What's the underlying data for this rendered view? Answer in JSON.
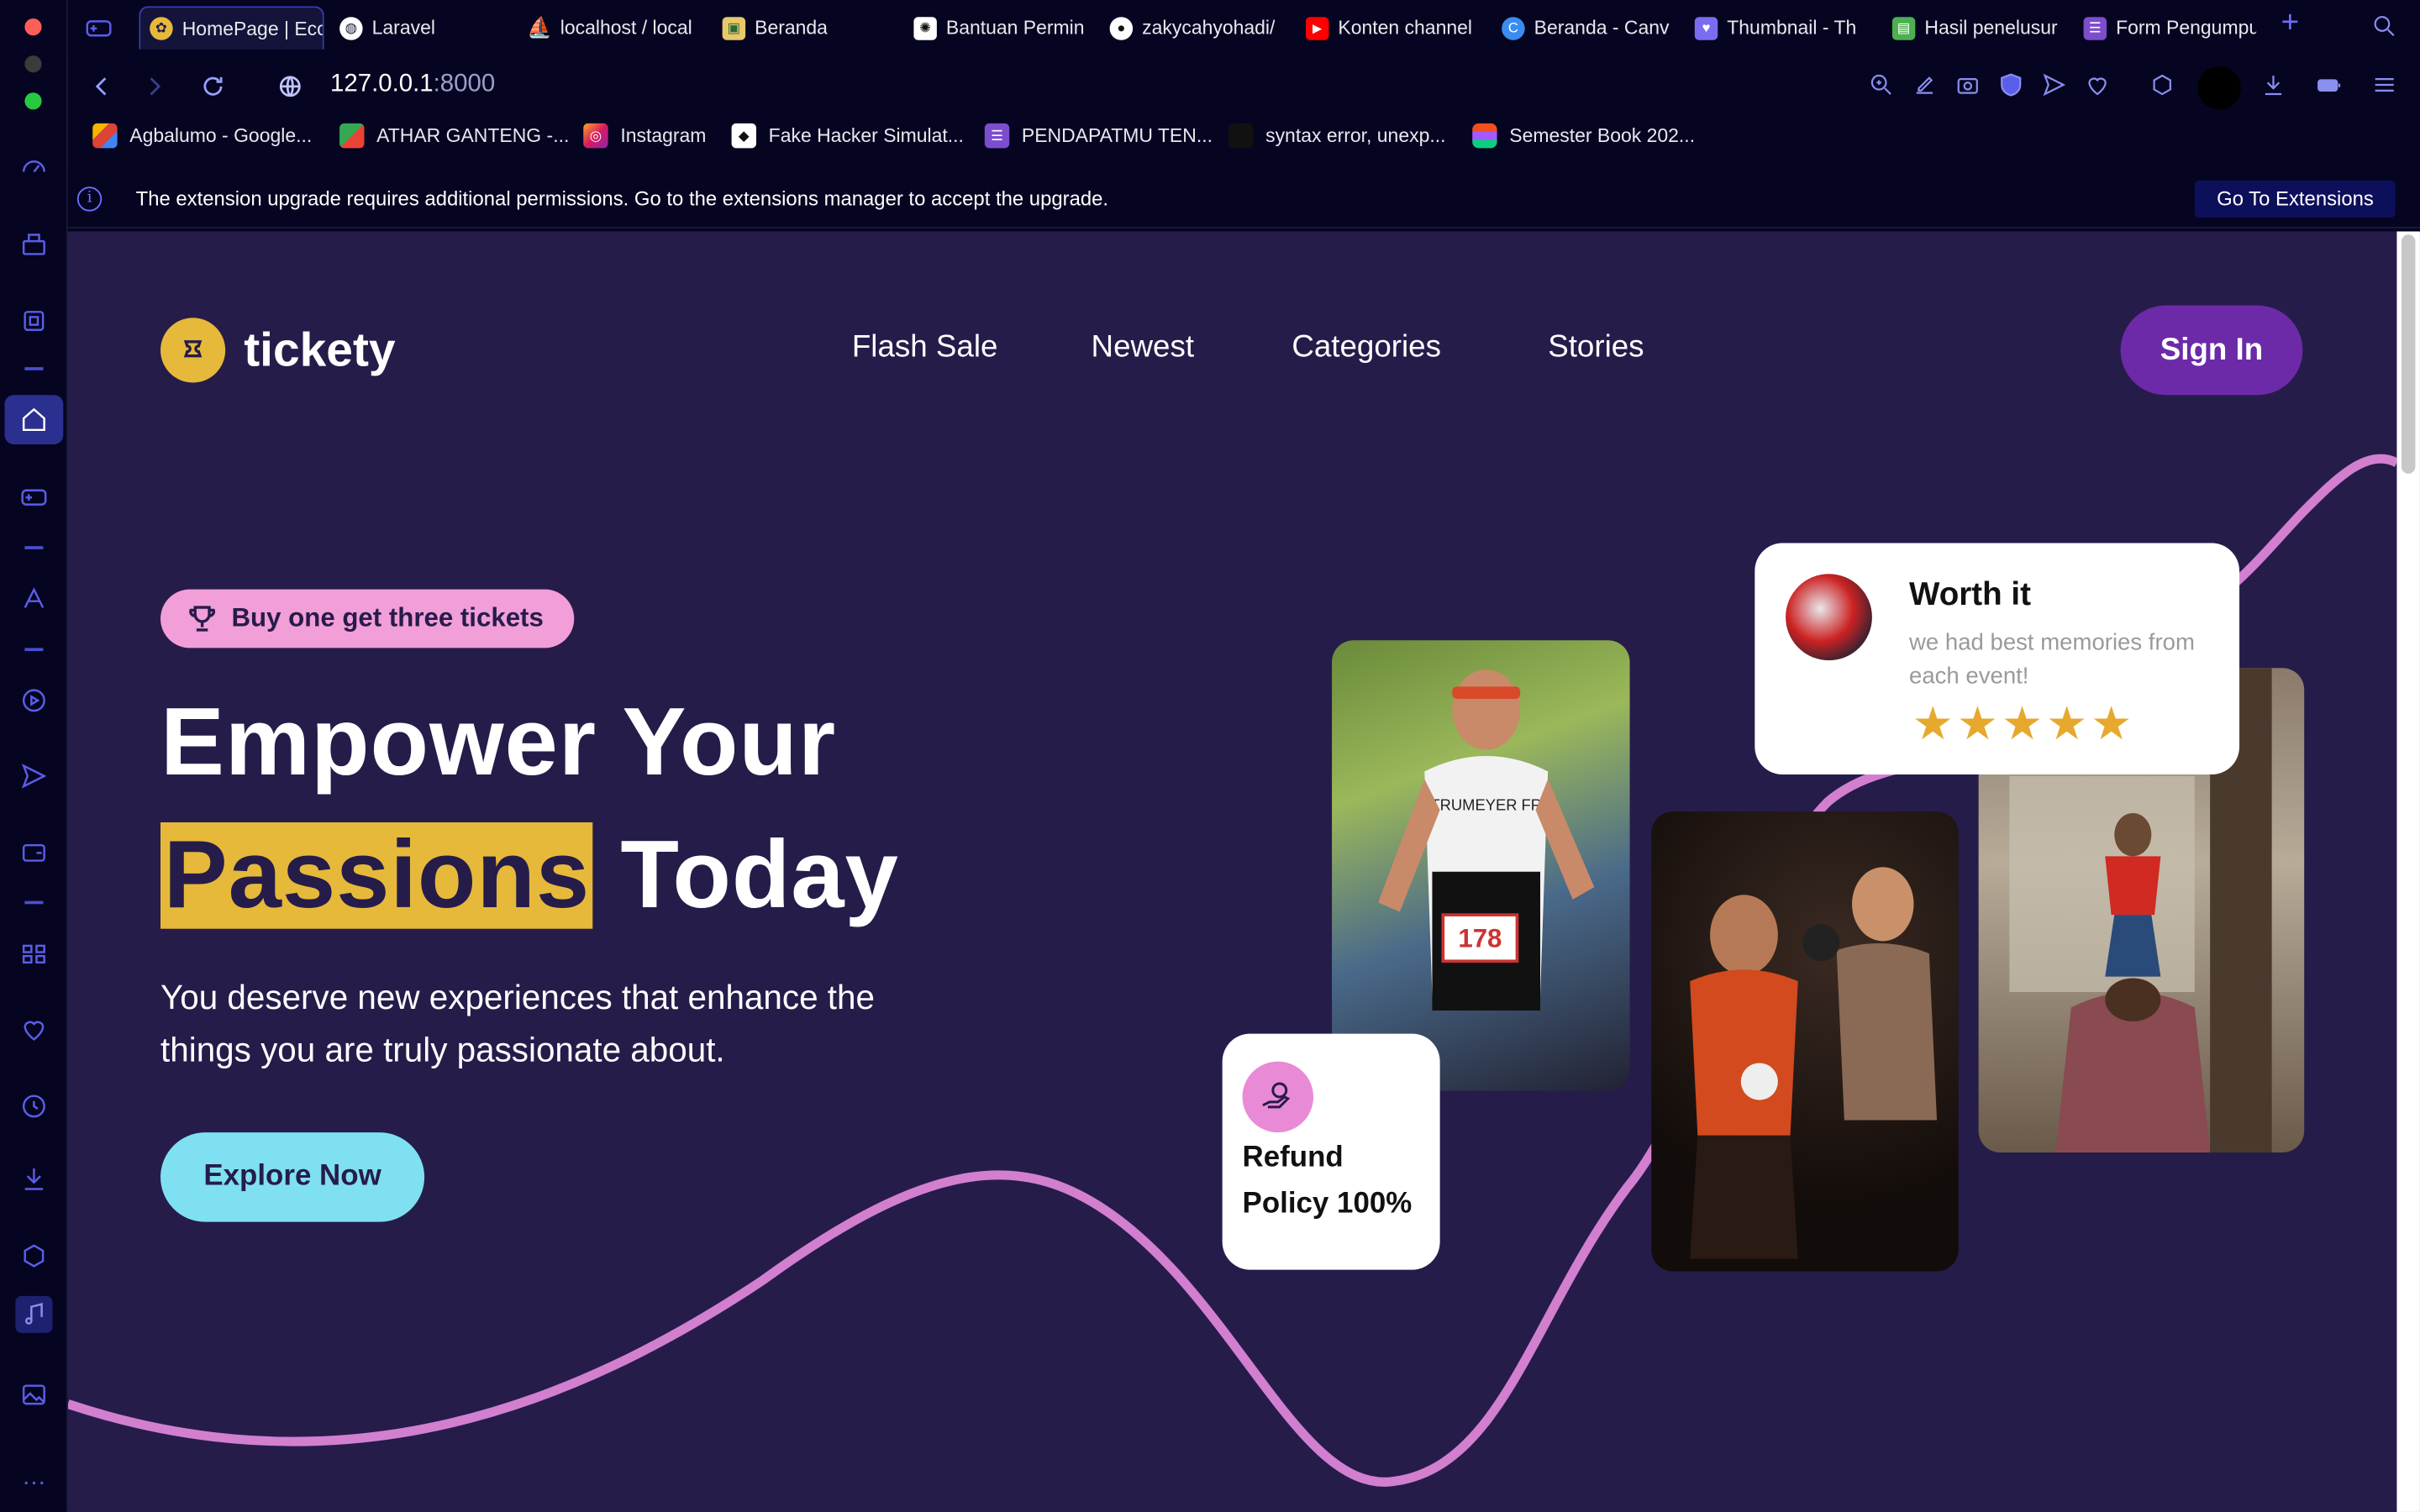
{
  "browser": {
    "tabs": [
      {
        "label": "HomePage | Ecc",
        "active": true
      },
      {
        "label": "Laravel"
      },
      {
        "label": "localhost / local"
      },
      {
        "label": "Beranda"
      },
      {
        "label": "Bantuan Permin"
      },
      {
        "label": "zakycahyohadi/"
      },
      {
        "label": "Konten channel"
      },
      {
        "label": "Beranda - Canv"
      },
      {
        "label": "Thumbnail - Th"
      },
      {
        "label": "Hasil penelusur"
      },
      {
        "label": "Form Pengumpu"
      }
    ],
    "url_host": "127.0.0.1",
    "url_port": ":8000",
    "bookmarks": [
      "Agbalumo - Google...",
      "ATHAR GANTENG -...",
      "Instagram",
      "Fake Hacker Simulat...",
      "PENDAPATMU TEN...",
      "syntax error, unexp...",
      "Semester Book 202..."
    ],
    "info_message": "The extension upgrade requires additional permissions. Go to the extensions manager to accept the upgrade.",
    "info_button": "Go To Extensions",
    "info_glyph": "i",
    "plus_glyph": "+",
    "more_glyph": "…"
  },
  "site": {
    "brand": "tickety",
    "nav": [
      "Flash Sale",
      "Newest",
      "Categories",
      "Stories"
    ],
    "sign_in": "Sign In",
    "promo": "Buy one get three tickets",
    "headline_line1": "Empower Your",
    "headline_highlight": "Passions",
    "headline_rest": "Today",
    "subtitle": "You deserve new experiences that enhance the things you are truly passionate about.",
    "cta": "Explore Now",
    "review": {
      "title": "Worth it",
      "text": "we had best memories from each event!",
      "rating": 5
    },
    "refund": "Refund Policy 100%",
    "runner_bib": "178",
    "runner_jersey": "STRUMEYER FRA",
    "colors": {
      "page_bg": "#261c4a",
      "accent_yellow": "#e6b93a",
      "accent_purple": "#6c2aa8",
      "accent_pink": "#f29ed8",
      "accent_cyan": "#7fe0f2",
      "curve": "#d27fd0"
    }
  }
}
